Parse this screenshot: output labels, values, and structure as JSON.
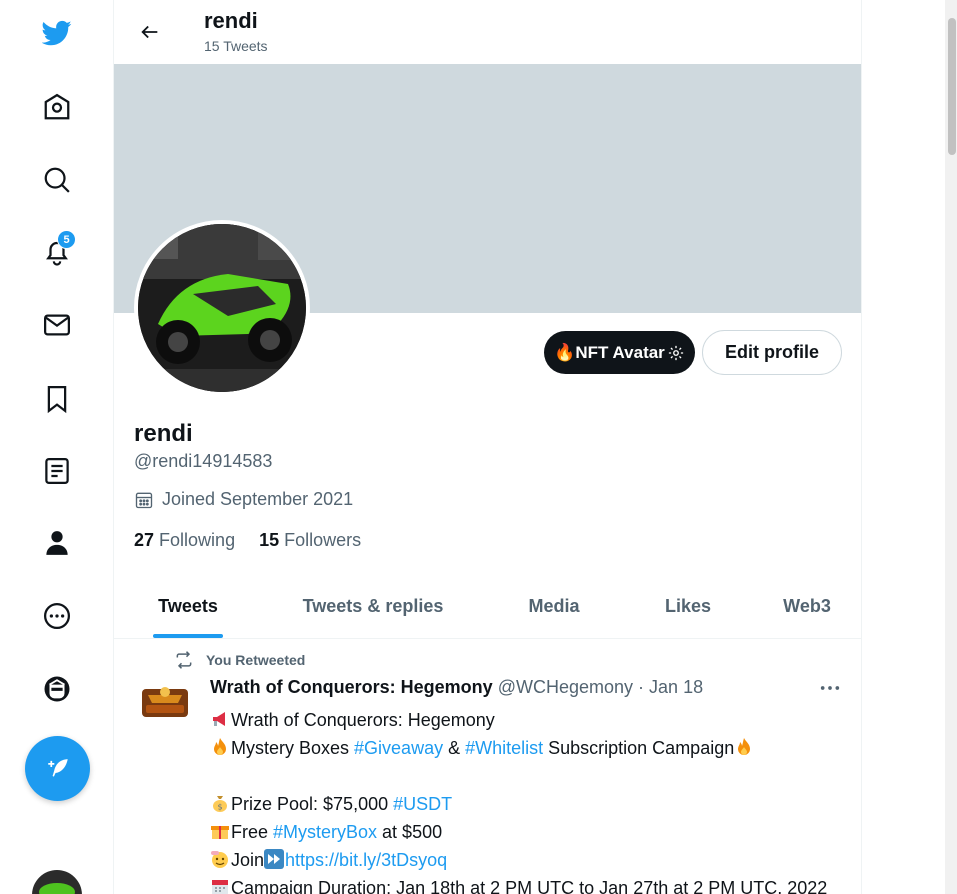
{
  "nav": {
    "items": [
      {
        "name": "twitter-logo-icon"
      },
      {
        "name": "home-icon"
      },
      {
        "name": "explore-search-icon"
      },
      {
        "name": "notifications-bell-icon"
      },
      {
        "name": "messages-envelope-icon"
      },
      {
        "name": "bookmarks-icon"
      },
      {
        "name": "lists-icon"
      },
      {
        "name": "profile-person-icon"
      },
      {
        "name": "more-circle-icon"
      },
      {
        "name": "nft-avatar-nav-icon"
      }
    ],
    "notification_count": "5",
    "accent_color": "#1d9bf0"
  },
  "header": {
    "name": "rendi",
    "tweet_count": "15 Tweets"
  },
  "profile": {
    "nft_button_label": "🔥NFT Avatar",
    "edit_button_label": "Edit profile",
    "display_name": "rendi",
    "handle": "@rendi14914583",
    "joined": "Joined September 2021",
    "following_count": "27",
    "following_label": "Following",
    "followers_count": "15",
    "followers_label": "Followers"
  },
  "tabs": [
    {
      "label": "Tweets",
      "active": true
    },
    {
      "label": "Tweets & replies",
      "active": false
    },
    {
      "label": "Media",
      "active": false
    },
    {
      "label": "Likes",
      "active": false
    },
    {
      "label": "Web3",
      "active": false
    }
  ],
  "tweet": {
    "retweet_label": "You Retweeted",
    "author_name": "Wrath of Conquerors: Hegemony",
    "author_handle": "@WCHegemony",
    "separator": "·",
    "date": "Jan 18",
    "lines": {
      "l1_text": "Wrath of Conquerors: Hegemony",
      "l2_a": "Mystery Boxes ",
      "l2_tag1": "#Giveaway",
      "l2_b": " & ",
      "l2_tag2": "#Whitelist",
      "l2_c": " Subscription Campaign",
      "l4_text": "Prize Pool: $75,000 ",
      "l4_tag": "#USDT",
      "l5_a": "Free ",
      "l5_tag": "#MysteryBox",
      "l5_b": " at $500",
      "l6_a": "Join",
      "l6_link": "https://bit.ly/3tDsyoq",
      "l7_text": "Campaign Duration: Jan 18th at 2 PM UTC to Jan 27th at 2 PM UTC, 2022"
    }
  }
}
